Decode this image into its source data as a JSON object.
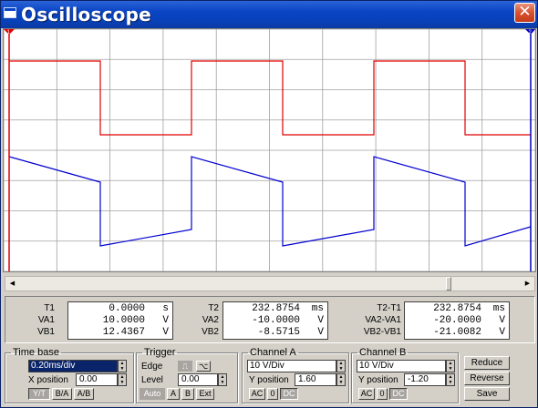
{
  "window": {
    "title": "Oscilloscope",
    "close_glyph": "✕"
  },
  "screen": {
    "channel_a_color": "#e00000",
    "channel_b_color": "#0000d0",
    "grid_color": "#a0a0a0",
    "cursor_1_color": "#e00000",
    "cursor_2_color": "#0000c0",
    "cursor_1_label": "1",
    "cursor_2_label": "2"
  },
  "scrollbar": {
    "left_glyph": "◀",
    "right_glyph": "▶",
    "position_fraction": 0.86
  },
  "readout": {
    "t1": {
      "label": "T1",
      "value": "0.0000",
      "unit": "s",
      "va": {
        "label": "VA1",
        "value": "10.0000",
        "unit": "V"
      },
      "vb": {
        "label": "VB1",
        "value": "12.4367",
        "unit": "V"
      }
    },
    "t2": {
      "label": "T2",
      "value": "232.8754",
      "unit": "ms",
      "va": {
        "label": "VA2",
        "value": "-10.0000",
        "unit": "V"
      },
      "vb": {
        "label": "VB2",
        "value": "-8.5715",
        "unit": "V"
      }
    },
    "diff": {
      "label": "T2-T1",
      "value": "232.8754",
      "unit": "ms",
      "va": {
        "label": "VA2-VA1",
        "value": "-20.0000",
        "unit": "V"
      },
      "vb": {
        "label": "VB2-VB1",
        "value": "-21.0082",
        "unit": "V"
      }
    }
  },
  "timebase": {
    "legend": "Time base",
    "scale": "0.20ms/div",
    "xpos_label": "X position",
    "xpos_value": "0.00",
    "modes": [
      "Y/T",
      "B/A",
      "A/B"
    ],
    "active_mode": "Y/T"
  },
  "trigger": {
    "legend": "Trigger",
    "edge_label": "Edge",
    "level_label": "Level",
    "level_value": "0.00",
    "rising_icon": "rising-edge-icon",
    "falling_icon": "falling-edge-icon",
    "rising_glyph": "⎍",
    "falling_glyph": "⌥",
    "sources": [
      "Auto",
      "A",
      "B",
      "Ext"
    ]
  },
  "channel_a": {
    "legend": "Channel A",
    "scale": "10 V/Div",
    "ypos_label": "Y position",
    "ypos_value": "1.60",
    "couplings": [
      "AC",
      "0",
      "DC"
    ],
    "active_coupling": "DC"
  },
  "channel_b": {
    "legend": "Channel B",
    "scale": "10 V/Div",
    "ypos_label": "Y position",
    "ypos_value": "-1.20",
    "couplings": [
      "AC",
      "0",
      "DC"
    ],
    "active_coupling": "DC"
  },
  "actions": {
    "reduce": "Reduce",
    "reverse": "Reverse",
    "save": "Save"
  }
}
